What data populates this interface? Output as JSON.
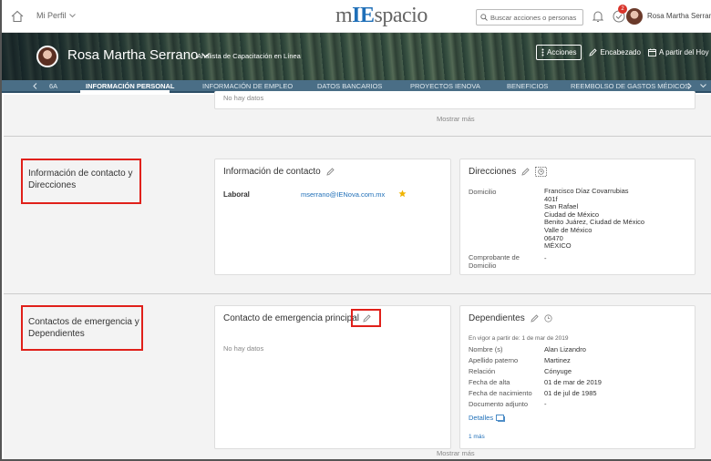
{
  "topbar": {
    "my_profile": "Mi Perfil",
    "logo_m": "m",
    "logo_ie": "IE",
    "logo_rest": "spacio",
    "search_placeholder": "Buscar acciones o personas",
    "notification_count": "2",
    "user_name": "Rosa Martha Serrano"
  },
  "banner": {
    "name": "Rosa Martha Serrano",
    "job_title": "Analista de Capacitación en Línea",
    "actions_label": "Acciones",
    "header_label": "Encabezado",
    "as_of_label": "A partir del Hoy"
  },
  "tabs": [
    {
      "label": "6A"
    },
    {
      "label": "INFORMACIÓN PERSONAL"
    },
    {
      "label": "INFORMACIÓN DE EMPLEO"
    },
    {
      "label": "DATOS BANCARIOS"
    },
    {
      "label": "PROYECTOS IENOVA"
    },
    {
      "label": "BENEFICIOS"
    },
    {
      "label": "REEMBOLSO DE GASTOS MÉDICOS"
    }
  ],
  "top_section": {
    "no_data": "No hay datos",
    "show_more": "Mostrar más"
  },
  "contact_section": {
    "label": "Información de contacto y Direcciones",
    "contact_card": {
      "title": "Información de contacto",
      "type": "Laboral",
      "email": "mserrano@IENova.com.mx"
    },
    "address_card": {
      "title": "Direcciones",
      "domicile_label": "Domicilio",
      "address_lines": [
        "Francisco Díaz Covarrubias",
        "401f",
        "San Rafael",
        "Ciudad de México",
        "Benito Juárez, Ciudad de México",
        "Valle de México",
        "06470",
        "MÉXICO"
      ],
      "proof_label": "Comprobante de Domicilio",
      "proof_value": "-"
    }
  },
  "emergency_section": {
    "label": "Contactos de emergencia y Dependientes",
    "emergency_card": {
      "title": "Contacto de emergencia principal",
      "no_data": "No hay datos"
    },
    "dependents_card": {
      "title": "Dependientes",
      "effective": "En vigor a partir de: 1 de mar de 2019",
      "rows": [
        {
          "label": "Nombre (s)",
          "value": "Alan Lizandro"
        },
        {
          "label": "Apellido paterno",
          "value": "Martinez"
        },
        {
          "label": "Relación",
          "value": "Cónyuge"
        },
        {
          "label": "Fecha de alta",
          "value": "01 de mar de 2019"
        },
        {
          "label": "Fecha de nacimiento",
          "value": "01 de jul de 1985"
        },
        {
          "label": "Documento adjunto",
          "value": "-"
        }
      ],
      "details_link": "Detalles",
      "more_link": "1 más"
    },
    "show_more": "Mostrar más"
  },
  "colors": {
    "accent": "#1f6fb8",
    "highlight_box": "#e0201a",
    "tab_bar": "#4a6e86",
    "star": "#f0b400"
  }
}
